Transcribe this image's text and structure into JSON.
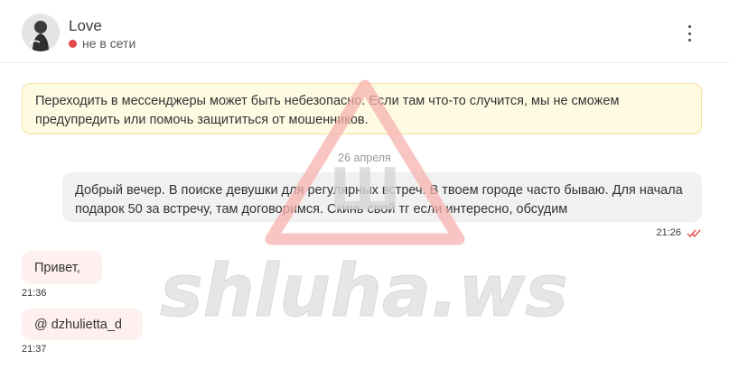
{
  "colors": {
    "offline_dot": "#e5484d",
    "warning_bg": "#fffbe3",
    "incoming_bg": "#fdf0ee",
    "read_ticks": "#e5484d",
    "watermark_triangle": "#f6b1ad",
    "watermark_text": "#dcdcdc"
  },
  "header": {
    "name": "Love",
    "status": "не в сети"
  },
  "warning": {
    "text": "Переходить в мессенджеры может быть небезопасно. Если там что-то случится, мы не сможем предупредить или помочь защититься от мошенников."
  },
  "date_separator": "26 апреля",
  "messages": [
    {
      "direction": "outgoing",
      "text": "Добрый вечер. В поиске девушки для регулярных встреч. В твоем городе часто бываю. Для начала подарок 50 за встречу, там договоримся. Скинь свой тг если интересно, обсудим",
      "time": "21:26",
      "read": true
    },
    {
      "direction": "incoming",
      "text": "Привет,",
      "time": "21:36"
    },
    {
      "direction": "incoming",
      "text": "@ dzhulietta_d",
      "time": "21:37"
    }
  ],
  "watermark": {
    "letter": "Ш",
    "text": "shluha.ws"
  }
}
